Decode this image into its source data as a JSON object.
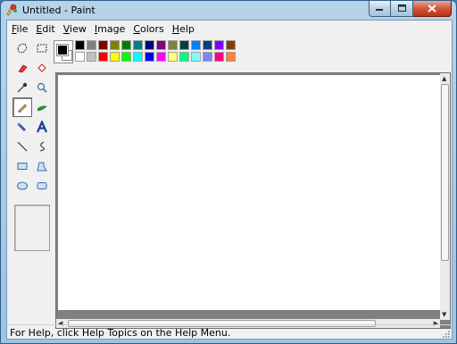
{
  "window": {
    "title": "Untitled - Paint"
  },
  "menus": [
    {
      "label": "File",
      "u": "F",
      "rest": "ile"
    },
    {
      "label": "Edit",
      "u": "E",
      "rest": "dit"
    },
    {
      "label": "View",
      "u": "V",
      "rest": "iew"
    },
    {
      "label": "Image",
      "u": "I",
      "rest": "mage"
    },
    {
      "label": "Colors",
      "u": "C",
      "rest": "olors"
    },
    {
      "label": "Help",
      "u": "H",
      "rest": "elp"
    }
  ],
  "palette": {
    "top_row": [
      "#000000",
      "#808080",
      "#800000",
      "#808000",
      "#008000",
      "#008080",
      "#000080",
      "#800080",
      "#808040",
      "#004040",
      "#0080ff",
      "#004080",
      "#8000ff",
      "#804000"
    ],
    "bottom_row": [
      "#ffffff",
      "#c0c0c0",
      "#ff0000",
      "#ffff00",
      "#00ff00",
      "#00ffff",
      "#0000ff",
      "#ff00ff",
      "#ffff80",
      "#00ff80",
      "#80ffff",
      "#8080ff",
      "#ff0080",
      "#ff8040"
    ]
  },
  "tools": [
    "free-form-select",
    "select",
    "eraser",
    "fill-with-color",
    "pick-color",
    "magnifier",
    "pencil",
    "brush",
    "airbrush",
    "text",
    "line",
    "curve",
    "rectangle",
    "polygon",
    "ellipse",
    "rounded-rectangle"
  ],
  "status": {
    "text": "For Help, click Help Topics on the Help Menu."
  }
}
